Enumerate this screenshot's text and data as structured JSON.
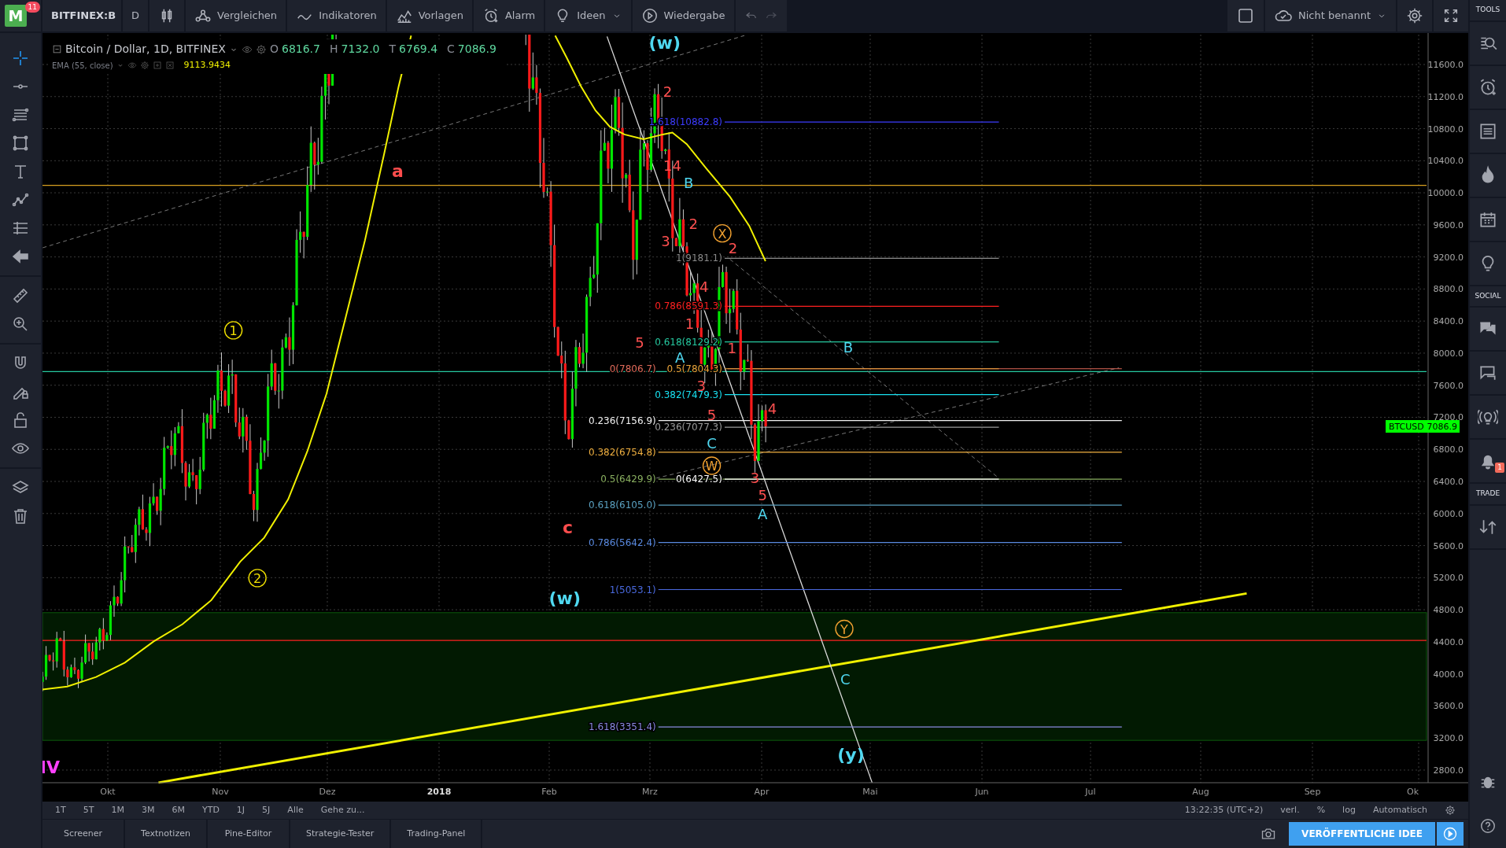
{
  "app": {
    "logo": "M",
    "badge": "11"
  },
  "toolbar": {
    "symbol": "BITFINEX:B",
    "interval": "D",
    "buttons": [
      {
        "label": "Vergleichen",
        "kind": "compare",
        "dropdown": false
      },
      {
        "label": "Indikatoren",
        "kind": "indicators",
        "dropdown": false
      },
      {
        "label": "Vorlagen",
        "kind": "templates",
        "dropdown": false
      },
      {
        "label": "Alarm",
        "kind": "alarm",
        "dropdown": false
      },
      {
        "label": "Ideen",
        "kind": "ideas",
        "dropdown": true
      },
      {
        "label": "Wiedergabe",
        "kind": "replay",
        "dropdown": false
      }
    ],
    "layout_name": "Nicht benannt"
  },
  "legend": {
    "title": "Bitcoin / Dollar, 1D, BITFINEX",
    "ohlc": [
      {
        "key": "O",
        "value": "6816.7"
      },
      {
        "key": "H",
        "value": "7132.0"
      },
      {
        "key": "T",
        "value": "6769.4"
      },
      {
        "key": "C",
        "value": "7086.9"
      }
    ],
    "indicator": "EMA (55, close)",
    "indicator_value": "9113.9434"
  },
  "price_axis": [
    "11600.0",
    "11200.0",
    "10800.0",
    "10400.0",
    "10000.0",
    "9600.0",
    "9200.0",
    "8800.0",
    "8400.0",
    "8000.0",
    "7600.0",
    "7200.0",
    "6800.0",
    "6400.0",
    "6000.0",
    "5600.0",
    "5200.0",
    "4800.0",
    "4400.0",
    "4000.0",
    "3600.0",
    "3200.0",
    "2800.0"
  ],
  "price_tag": {
    "symbol": "BTCUSD",
    "value": "7086.9"
  },
  "time_axis": [
    {
      "label": "Okt",
      "kind": "month"
    },
    {
      "label": "Nov",
      "kind": "month"
    },
    {
      "label": "Dez",
      "kind": "month"
    },
    {
      "label": "2018",
      "kind": "year"
    },
    {
      "label": "Feb",
      "kind": "month"
    },
    {
      "label": "Mrz",
      "kind": "month"
    },
    {
      "label": "Apr",
      "kind": "month"
    },
    {
      "label": "Mai",
      "kind": "month"
    },
    {
      "label": "Jun",
      "kind": "month"
    },
    {
      "label": "Jul",
      "kind": "month"
    },
    {
      "label": "Aug",
      "kind": "month"
    },
    {
      "label": "Sep",
      "kind": "month"
    },
    {
      "label": "Ok",
      "kind": "month"
    }
  ],
  "fib_levels": [
    {
      "label": "1.618(10882.8)",
      "color": "#3c3cff"
    },
    {
      "label": "1(9181.1)",
      "color": "#8a8a8a"
    },
    {
      "label": "0.786(8591.3)",
      "color": "#ff2020"
    },
    {
      "label": "0.618(8129.2)",
      "color": "#26c9a0"
    },
    {
      "label": "0(7806.7)",
      "color": "#e06a5a"
    },
    {
      "label": "0.5(7804.3)",
      "color": "#e8a33a"
    },
    {
      "label": "0.382(7479.3)",
      "color": "#18e0f0"
    },
    {
      "label": "0.236(7156.9)",
      "color": "#f2f2f2"
    },
    {
      "label": "0.236(7077.3)",
      "color": "#9a9a9a"
    },
    {
      "label": "0.382(6754.8)",
      "color": "#f0b040"
    },
    {
      "label": "0.5(6429.9)",
      "color": "#8ab060"
    },
    {
      "label": "0(6427.5)",
      "color": "#ffffff"
    },
    {
      "label": "0.618(6105.0)",
      "color": "#5aa0c0"
    },
    {
      "label": "0.786(5642.4)",
      "color": "#5a8ae0"
    },
    {
      "label": "1(5053.1)",
      "color": "#4a6ae0"
    },
    {
      "label": "1.618(3351.4)",
      "color": "#8a8ae0"
    }
  ],
  "annotations": [
    {
      "text": "(w)",
      "kind": "wave",
      "color": "#4fd8f0"
    },
    {
      "text": "a",
      "kind": "wave",
      "color": "#ff4d4d"
    },
    {
      "text": "1",
      "kind": "circled",
      "color": "#f0e000"
    },
    {
      "text": "2",
      "kind": "circled",
      "color": "#f0e000"
    },
    {
      "text": "c",
      "kind": "wave",
      "color": "#ff4d4d"
    },
    {
      "text": "(w)",
      "kind": "wave",
      "color": "#4fd8f0"
    },
    {
      "text": "IV",
      "kind": "wave",
      "color": "#ff40ff"
    },
    {
      "text": "2",
      "kind": "plain",
      "color": "#ff5050"
    },
    {
      "text": "14",
      "kind": "plain",
      "color": "#ff5050"
    },
    {
      "text": "B",
      "kind": "plain",
      "color": "#4fd8f0"
    },
    {
      "text": "2",
      "kind": "plain",
      "color": "#ff5050"
    },
    {
      "text": "X",
      "kind": "circled",
      "color": "#f0a030"
    },
    {
      "text": "3",
      "kind": "plain",
      "color": "#ff5050"
    },
    {
      "text": "2",
      "kind": "plain",
      "color": "#ff5050"
    },
    {
      "text": "4",
      "kind": "plain",
      "color": "#ff5050"
    },
    {
      "text": "1",
      "kind": "plain",
      "color": "#ff5050"
    },
    {
      "text": "5",
      "kind": "plain",
      "color": "#ff5050"
    },
    {
      "text": "A",
      "kind": "plain",
      "color": "#4fd8f0"
    },
    {
      "text": "1",
      "kind": "plain",
      "color": "#ff5050"
    },
    {
      "text": "3",
      "kind": "plain",
      "color": "#ff5050"
    },
    {
      "text": "5",
      "kind": "plain",
      "color": "#ff5050"
    },
    {
      "text": "C",
      "kind": "plain",
      "color": "#4fd8f0"
    },
    {
      "text": "4",
      "kind": "plain",
      "color": "#ff5050"
    },
    {
      "text": "W",
      "kind": "circled",
      "color": "#f0a030"
    },
    {
      "text": "3",
      "kind": "plain",
      "color": "#ff5050"
    },
    {
      "text": "5",
      "kind": "plain",
      "color": "#ff5050"
    },
    {
      "text": "A",
      "kind": "plain",
      "color": "#4fd8f0"
    },
    {
      "text": "B",
      "kind": "plain",
      "color": "#4fd8f0"
    },
    {
      "text": "Y",
      "kind": "circled",
      "color": "#f0a030"
    },
    {
      "text": "C",
      "kind": "plain",
      "color": "#4fd8f0"
    },
    {
      "text": "(y)",
      "kind": "wave",
      "color": "#4fd8f0"
    }
  ],
  "range_buttons": [
    "1T",
    "5T",
    "1M",
    "3M",
    "6M",
    "YTD",
    "1J",
    "5J",
    "Alle"
  ],
  "goto": "Gehe zu...",
  "status": {
    "time": "13:22:35 (UTC+2)",
    "options": [
      "verl.",
      "%",
      "log",
      "Automatisch"
    ]
  },
  "bottom_tabs": [
    "Screener",
    "Textnotizen",
    "Pine-Editor",
    "Strategie-Tester",
    "Trading-Panel"
  ],
  "publish_button": "VERÖFFENTLICHE IDEE",
  "sidebar": {
    "sections": [
      "TOOLS",
      "SOCIAL",
      "TRADE"
    ],
    "notification_badge": "1"
  }
}
